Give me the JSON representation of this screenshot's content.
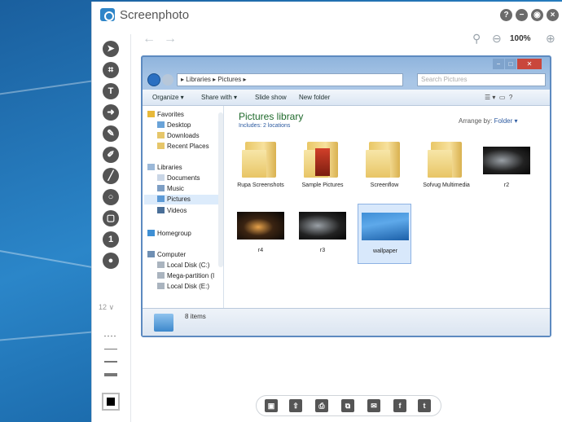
{
  "app": {
    "title": "Screenphoto",
    "window_buttons": [
      "?",
      "−",
      "◉",
      "×"
    ],
    "zoom": "100%",
    "brush_size": "12 ∨"
  },
  "captured_explorer": {
    "address": "▸ Libraries ▸ Pictures ▸",
    "search_placeholder": "Search Pictures",
    "commands": [
      "Organize ▾",
      "Share with ▾",
      "Slide show",
      "New folder"
    ],
    "nav": {
      "favorites": "Favorites",
      "favorites_items": [
        "Desktop",
        "Downloads",
        "Recent Places"
      ],
      "libraries": "Libraries",
      "libraries_items": [
        "Documents",
        "Music",
        "Pictures",
        "Videos"
      ],
      "homegroup": "Homegroup",
      "computer": "Computer",
      "computer_items": [
        "Local Disk (C:)",
        "Mega-partition (I",
        "Local Disk (E:)"
      ]
    },
    "library_title": "Pictures library",
    "library_subtitle": "Includes: 2 locations",
    "arrange_by": "Arrange by:",
    "arrange_value": "Folder ▾",
    "items": [
      {
        "label": "Rupa Screenshots",
        "kind": "folder"
      },
      {
        "label": "Sample Pictures",
        "kind": "folder-photo"
      },
      {
        "label": "Screenflow",
        "kind": "folder"
      },
      {
        "label": "Sofvug Multimedia",
        "kind": "folder"
      },
      {
        "label": "r2",
        "kind": "photo"
      },
      {
        "label": "r4",
        "kind": "photo"
      },
      {
        "label": "r3",
        "kind": "photo"
      },
      {
        "label": "wallpaper",
        "kind": "photo-blue"
      }
    ],
    "status": "8 items"
  }
}
